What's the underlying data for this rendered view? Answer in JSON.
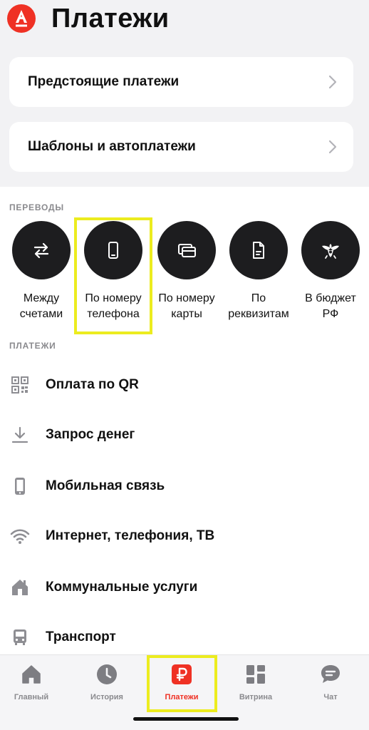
{
  "header": {
    "title": "Платежи",
    "logo_icon": "alfa-logo-icon",
    "accent": "#ef3124"
  },
  "cards": [
    {
      "label": "Предстоящие платежи"
    },
    {
      "label": "Шаблоны и автоплатежи"
    }
  ],
  "transfers": {
    "section_label": "ПЕРЕВОДЫ",
    "items": [
      {
        "label": "Между\nсчетами",
        "icon": "swap-arrows-icon"
      },
      {
        "label": "По номеру\nтелефона",
        "icon": "phone-icon",
        "highlighted": true
      },
      {
        "label": "По номеру\nкарты",
        "icon": "cards-icon"
      },
      {
        "label": "По\nреквизитам",
        "icon": "document-icon"
      },
      {
        "label": "В бюджет\nРФ",
        "icon": "eagle-emblem-icon"
      }
    ]
  },
  "payments": {
    "section_label": "ПЛАТЕЖИ",
    "items": [
      {
        "label": "Оплата по QR",
        "icon": "qr-code-icon"
      },
      {
        "label": "Запрос денег",
        "icon": "download-arrow-icon"
      },
      {
        "label": "Мобильная связь",
        "icon": "smartphone-icon"
      },
      {
        "label": "Интернет, телефония, ТВ",
        "icon": "wifi-icon"
      },
      {
        "label": "Коммунальные услуги",
        "icon": "house-icon"
      },
      {
        "label": "Транспорт",
        "icon": "bus-icon"
      }
    ]
  },
  "tabbar": {
    "items": [
      {
        "label": "Главный",
        "icon": "home-icon"
      },
      {
        "label": "История",
        "icon": "clock-icon"
      },
      {
        "label": "Платежи",
        "icon": "ruble-icon",
        "active": true
      },
      {
        "label": "Витрина",
        "icon": "grid-icon"
      },
      {
        "label": "Чат",
        "icon": "chat-bubble-icon"
      }
    ]
  }
}
